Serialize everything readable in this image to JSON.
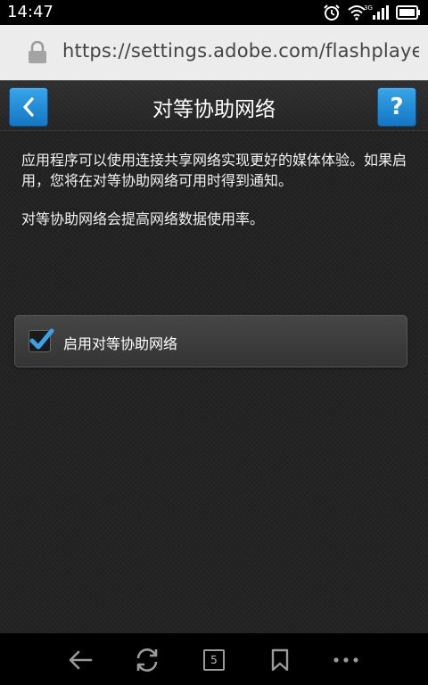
{
  "status_bar": {
    "time": "14:47",
    "network_label": "3G",
    "icons": [
      "alarm-icon",
      "wifi-icon",
      "signal-icon",
      "battery-icon"
    ]
  },
  "browser": {
    "url": "https://settings.adobe.com/flashplaye..",
    "lock_icon": "lock-icon"
  },
  "page": {
    "title": "对等协助网络",
    "back_icon": "chevron-left-icon",
    "help_label": "?",
    "description": [
      "应用程序可以使用连接共享网络实现更好的媒体体验。如果启用，您将在对等协助网络可用时得到通知。",
      "对等协助网络会提高网络数据使用率。"
    ],
    "option": {
      "label": "启用对等协助网络",
      "checked": true
    }
  },
  "nav_bar": {
    "tab_count": "5",
    "icons": [
      "back-arrow-icon",
      "refresh-icon",
      "tabs-icon",
      "bookmark-icon",
      "more-icon"
    ]
  },
  "colors": {
    "accent_blue": "#1e8ad6",
    "page_background": "#1f1f1f",
    "url_bar_background": "#ececec"
  }
}
